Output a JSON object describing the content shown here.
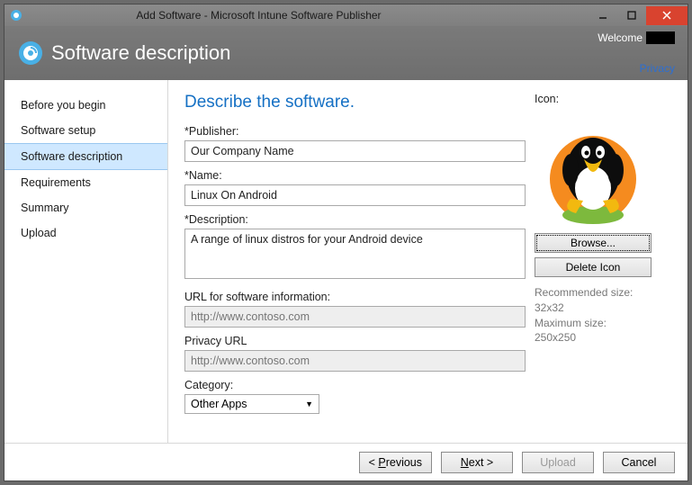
{
  "titlebar": {
    "title": "Add Software - Microsoft Intune Software Publisher"
  },
  "header": {
    "page_title": "Software description",
    "welcome": "Welcome",
    "privacy": "Privacy"
  },
  "sidebar": {
    "items": [
      {
        "label": "Before you begin"
      },
      {
        "label": "Software setup"
      },
      {
        "label": "Software description"
      },
      {
        "label": "Requirements"
      },
      {
        "label": "Summary"
      },
      {
        "label": "Upload"
      }
    ],
    "active_index": 2
  },
  "main": {
    "heading": "Describe the software.",
    "publisher": {
      "label": "Publisher:",
      "value": "Our Company Name"
    },
    "name": {
      "label": "Name:",
      "value": "Linux On Android"
    },
    "description": {
      "label": "Description:",
      "value": "A range of linux distros for your Android device"
    },
    "url_info": {
      "label": "URL for software information:",
      "placeholder": "http://www.contoso.com",
      "value": ""
    },
    "privacy_url": {
      "label": "Privacy URL",
      "placeholder": "http://www.contoso.com",
      "value": ""
    },
    "category": {
      "label": "Category:",
      "value": "Other Apps"
    }
  },
  "iconpanel": {
    "label": "Icon:",
    "browse": "Browse...",
    "delete": "Delete Icon",
    "hint1": "Recommended size:",
    "hint2": "32x32",
    "hint3": "Maximum size:",
    "hint4": "250x250"
  },
  "footer": {
    "previous_pre": "< ",
    "previous_ul": "P",
    "previous_post": "revious",
    "next_ul": "N",
    "next_post": "ext >",
    "upload": "Upload",
    "cancel": "Cancel"
  }
}
